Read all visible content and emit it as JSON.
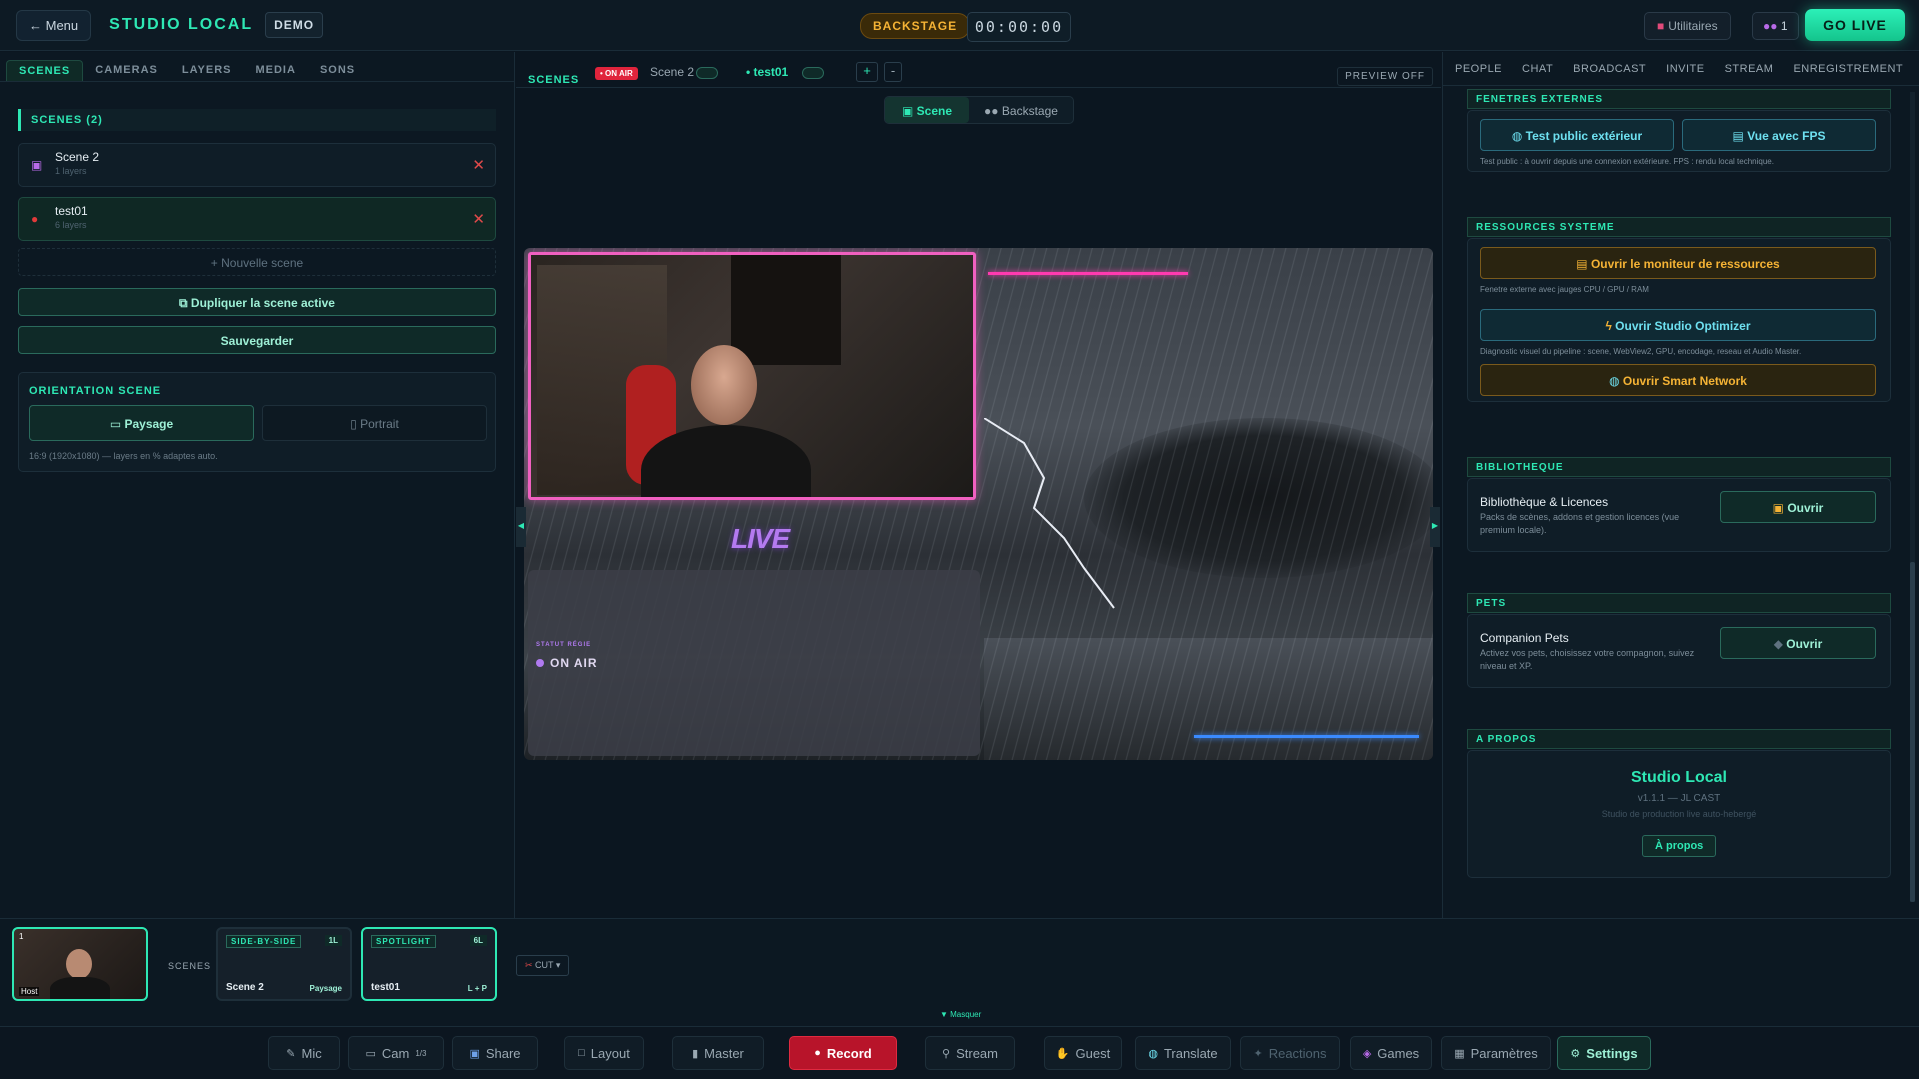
{
  "header": {
    "menu": "← Menu",
    "brand": "STUDIO LOCAL",
    "demo": "DEMO",
    "backstage": "BACKSTAGE",
    "timer": "00:00:00",
    "utilities": "Utilitaires",
    "people_count": "1",
    "go_live": "GO LIVE"
  },
  "left": {
    "tabs": [
      "SCENES",
      "CAMERAS",
      "LAYERS",
      "MEDIA",
      "SONS"
    ],
    "section": "SCENES (2)",
    "scenes": [
      {
        "name": "Scene 2",
        "sub": "1 layers"
      },
      {
        "name": "test01",
        "sub": "6 layers"
      }
    ],
    "new_scene": "+ Nouvelle scene",
    "duplicate": "Dupliquer la scene active",
    "save": "Sauvegarder",
    "orientation": {
      "title": "ORIENTATION SCENE",
      "landscape": "Paysage",
      "portrait": "Portrait",
      "note": "16:9 (1920x1080) — layers en % adaptes auto."
    }
  },
  "center": {
    "label": "SCENES",
    "on_air": "• ON AIR",
    "scene2": "Scene 2",
    "test01": "• test01",
    "plus": "+",
    "minus": "-",
    "preview": "PREVIEW OFF",
    "view_scene": "Scene",
    "view_backstage": "Backstage",
    "live": "LIVE",
    "statut": "STATUT RÉGIE",
    "onair_text": "ON AIR"
  },
  "right": {
    "tabs": [
      "PEOPLE",
      "CHAT",
      "BROADCAST",
      "INVITE",
      "STREAM",
      "ENREGISTREMENT"
    ],
    "ext": {
      "title": "FENETRES EXTERNES",
      "btn1": "Test public extérieur",
      "btn2": "Vue avec FPS",
      "note": "Test public : à ouvrir depuis une connexion extérieure. FPS : rendu local technique."
    },
    "res": {
      "title": "RESSOURCES SYSTEME",
      "btn1": "Ouvrir le moniteur de ressources",
      "note1": "Fenetre externe avec jauges CPU / GPU / RAM",
      "btn2": "Ouvrir Studio Optimizer",
      "note2": "Diagnostic visuel du pipeline : scene, WebView2, GPU, encodage, reseau et Audio Master.",
      "btn3": "Ouvrir Smart Network"
    },
    "lib": {
      "title": "BIBLIOTHEQUE",
      "h": "Bibliothèque & Licences",
      "d": "Packs de scènes, addons et gestion licences (vue premium locale).",
      "btn": "Ouvrir"
    },
    "pets": {
      "title": "PETS",
      "h": "Companion Pets",
      "d": "Activez vos pets, choisissez votre compagnon, suivez niveau et XP.",
      "btn": "Ouvrir"
    },
    "about": {
      "title": "A PROPOS",
      "name": "Studio Local",
      "version": "v1.1.1 — JL CAST",
      "sub": "Studio de production live auto-hebergé",
      "btn": "À propos"
    }
  },
  "strip": {
    "scenes_label": "SCENES",
    "cards": [
      {
        "tag": "SIDE-BY-SIDE",
        "count": "1L",
        "name": "Scene 2",
        "orient": "Paysage"
      },
      {
        "tag": "SPOTLIGHT",
        "count": "6L",
        "name": "test01",
        "orient": "L + P"
      }
    ],
    "cam_tag": "1",
    "host": "Host",
    "cut": "CUT",
    "hide": "▼ Masquer"
  },
  "toolbar": {
    "mic": "Mic",
    "cam": "Cam",
    "cam_count": "1/3",
    "share": "Share",
    "layout": "Layout",
    "master": "Master",
    "record": "Record",
    "stream": "Stream",
    "guest": "Guest",
    "translate": "Translate",
    "reactions": "Reactions",
    "games": "Games",
    "params": "Paramètres",
    "settings": "Settings"
  }
}
